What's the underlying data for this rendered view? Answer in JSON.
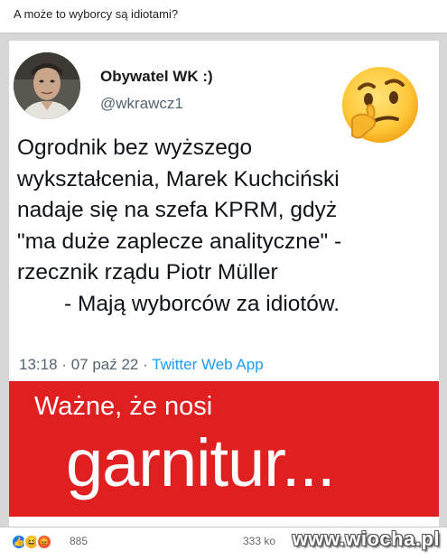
{
  "post": {
    "title": "A może to wyborcy są idiotami?"
  },
  "tweet": {
    "display_name": "Obywatel WK :)",
    "handle": "@wkrawcz1",
    "text_lines": [
      "Ogrodnik bez wyższego",
      "wykształcenia, Marek Kuchciński",
      "nadaje się na szefa KPRM, gdyż",
      "\"ma duże zaplecze analityczne\" -",
      "rzecznik rządu Piotr Müller",
      "- Mają wyborców za idiotów."
    ],
    "time": "13:18",
    "separator": "·",
    "date": "07 paź 22",
    "source": "Twitter Web App",
    "emoji_icon": "thinking-face-icon"
  },
  "banner": {
    "line1": "Ważne, że nosi",
    "line2": "garnitur...",
    "color": "#e02020"
  },
  "footer": {
    "reaction_count": "885",
    "comment_count": "333 ko",
    "watermark": "www.wiocha.pl",
    "reaction_icons": [
      "like-icon",
      "haha-icon",
      "angry-icon"
    ]
  },
  "colors": {
    "handle_gray": "#536471",
    "twitter_blue": "#1d9bf0",
    "banner_red": "#e02020",
    "facebook_blue": "#1877f2"
  }
}
